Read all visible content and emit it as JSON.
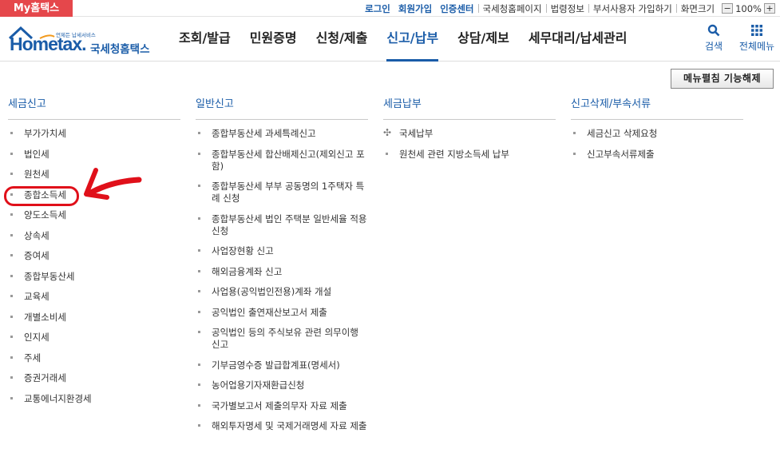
{
  "topbar": {
    "my_tab": "My홈택스",
    "links": [
      {
        "label": "로그인",
        "strong": true
      },
      {
        "label": "회원가입",
        "strong": true
      },
      {
        "label": "인증센터",
        "strong": true
      },
      {
        "label": "국세청홈페이지",
        "strong": false
      },
      {
        "label": "법령정보",
        "strong": false
      },
      {
        "label": "부서사용자 가입하기",
        "strong": false
      },
      {
        "label": "화면크기",
        "strong": false
      }
    ],
    "zoom_minus": "−",
    "zoom_value": "100%",
    "zoom_plus": "+"
  },
  "header": {
    "logo_tagline": "언제든 납세서비스",
    "logo_text": "Hometax.",
    "logo_kor": "국세청홈택스",
    "nav": [
      {
        "label": "조회/발급",
        "active": false
      },
      {
        "label": "민원증명",
        "active": false
      },
      {
        "label": "신청/제출",
        "active": false
      },
      {
        "label": "신고/납부",
        "active": true
      },
      {
        "label": "상담/제보",
        "active": false
      },
      {
        "label": "세무대리/납세관리",
        "active": false
      }
    ],
    "search_label": "검색",
    "fullmenu_label": "전체메뉴",
    "accent": "#1a5ca8"
  },
  "collapse_button": "메뉴펼침 기능해제",
  "columns": [
    {
      "title": "세금신고",
      "items": [
        "부가가치세",
        "법인세",
        "원천세",
        "종합소득세",
        "양도소득세",
        "상속세",
        "증여세",
        "종합부동산세",
        "교육세",
        "개별소비세",
        "인지세",
        "주세",
        "증권거래세",
        "교통에너지환경세"
      ]
    },
    {
      "title": "일반신고",
      "items": [
        "종합부동산세 과세특례신고",
        "종합부동산세 합산배제신고(제외신고 포함)",
        "종합부동산세 부부 공동명의 1주택자 특례 신청",
        "종합부동산세 법인 주택분 일반세율 적용 신청",
        "사업장현황 신고",
        "해외금융계좌 신고",
        "사업용(공익법인전용)계좌 개설",
        "공익법인 출연재산보고서 제출",
        "공익법인 등의 주식보유 관련 의무이행 신고",
        "기부금영수증 발급합계표(명세서)",
        "농어업용기자재환급신청",
        "국가별보고서 제출의무자 자료 제출",
        "해외투자명세 및 국제거래명세 자료 제출"
      ]
    },
    {
      "title": "세금납부",
      "items": [
        "국세납부",
        "원천세 관련 지방소득세 납부"
      ]
    },
    {
      "title": "신고삭제/부속서류",
      "items": [
        "세금신고 삭제요청",
        "신고부속서류제출"
      ]
    }
  ],
  "annotation_color": "#e0101a"
}
